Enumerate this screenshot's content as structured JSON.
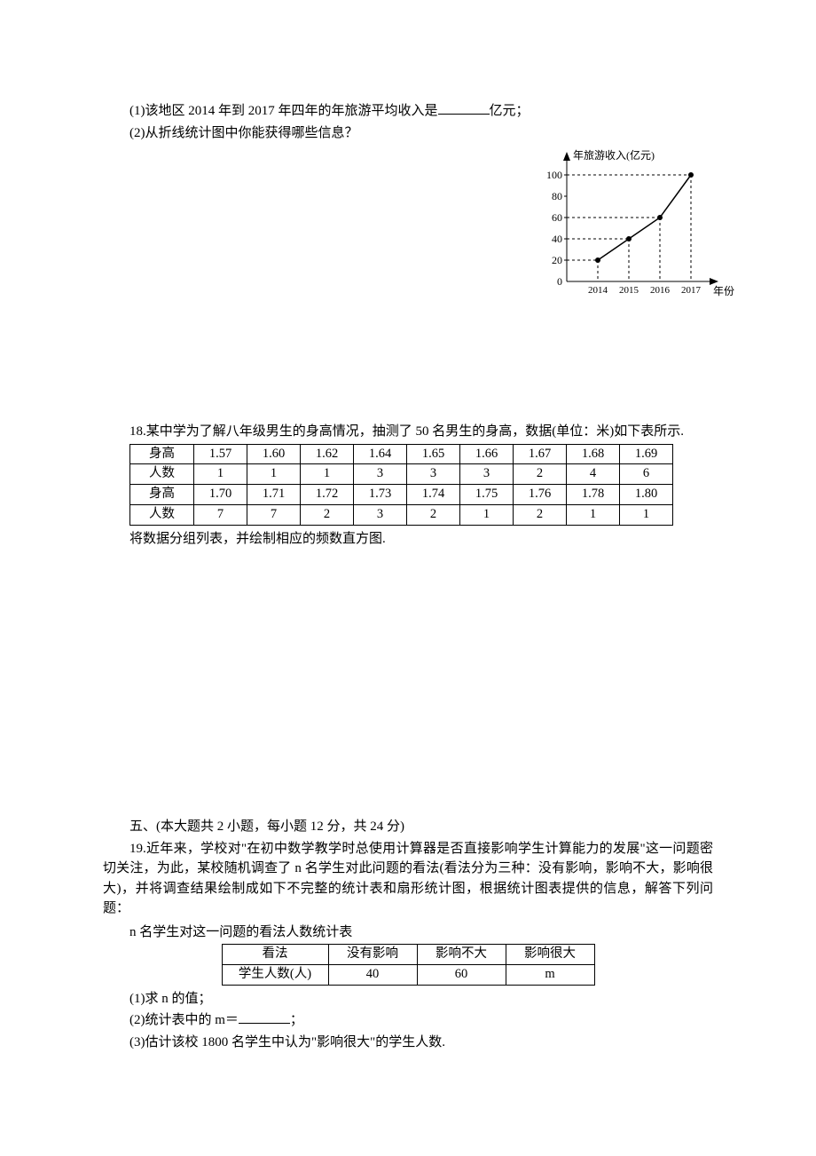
{
  "q17": {
    "p1a": "(1)该地区 2014 年到 2017 年四年的年旅游平均收入是",
    "p1b": "亿元；",
    "p2": "(2)从折线统计图中你能获得哪些信息？"
  },
  "chart_data": {
    "type": "line",
    "categories": [
      "2014",
      "2015",
      "2016",
      "2017"
    ],
    "values": [
      20,
      40,
      60,
      100
    ],
    "title": "",
    "ylabel": "年旅游收入(亿元)",
    "xlabel": "年份",
    "yticks": [
      0,
      20,
      40,
      60,
      80,
      100
    ],
    "ylim": [
      0,
      105
    ]
  },
  "q18": {
    "intro": "18.某中学为了解八年级男生的身高情况，抽测了 50 名男生的身高，数据(单位：米)如下表所示.",
    "row1_lbl": "身高",
    "row1": [
      "1.57",
      "1.60",
      "1.62",
      "1.64",
      "1.65",
      "1.66",
      "1.67",
      "1.68",
      "1.69"
    ],
    "row2_lbl": "人数",
    "row2": [
      "1",
      "1",
      "1",
      "3",
      "3",
      "3",
      "2",
      "4",
      "6"
    ],
    "row3_lbl": "身高",
    "row3": [
      "1.70",
      "1.71",
      "1.72",
      "1.73",
      "1.74",
      "1.75",
      "1.76",
      "1.78",
      "1.80"
    ],
    "row4_lbl": "人数",
    "row4": [
      "7",
      "7",
      "2",
      "3",
      "2",
      "1",
      "2",
      "1",
      "1"
    ],
    "after": "将数据分组列表，并绘制相应的频数直方图."
  },
  "section5": "五、(本大题共 2 小题，每小题 12 分，共 24 分)",
  "q19": {
    "p1": "19.近年来，学校对\"在初中数学教学时总使用计算器是否直接影响学生计算能力的发展\"这一问题密切关注，为此，某校随机调查了 n 名学生对此问题的看法(看法分为三种：没有影响，影响不大，影响很大)，并将调查结果绘制成如下不完整的统计表和扇形统计图，根据统计图表提供的信息，解答下列问题：",
    "tabletitle": "n 名学生对这一问题的看法人数统计表",
    "th": [
      "看法",
      "没有影响",
      "影响不大",
      "影响很大"
    ],
    "td": [
      "学生人数(人)",
      "40",
      "60",
      "m"
    ],
    "q1": "(1)求 n 的值；",
    "q2a": "(2)统计表中的 m＝",
    "q2b": "；",
    "q3": "(3)估计该校 1800 名学生中认为\"影响很大\"的学生人数."
  }
}
